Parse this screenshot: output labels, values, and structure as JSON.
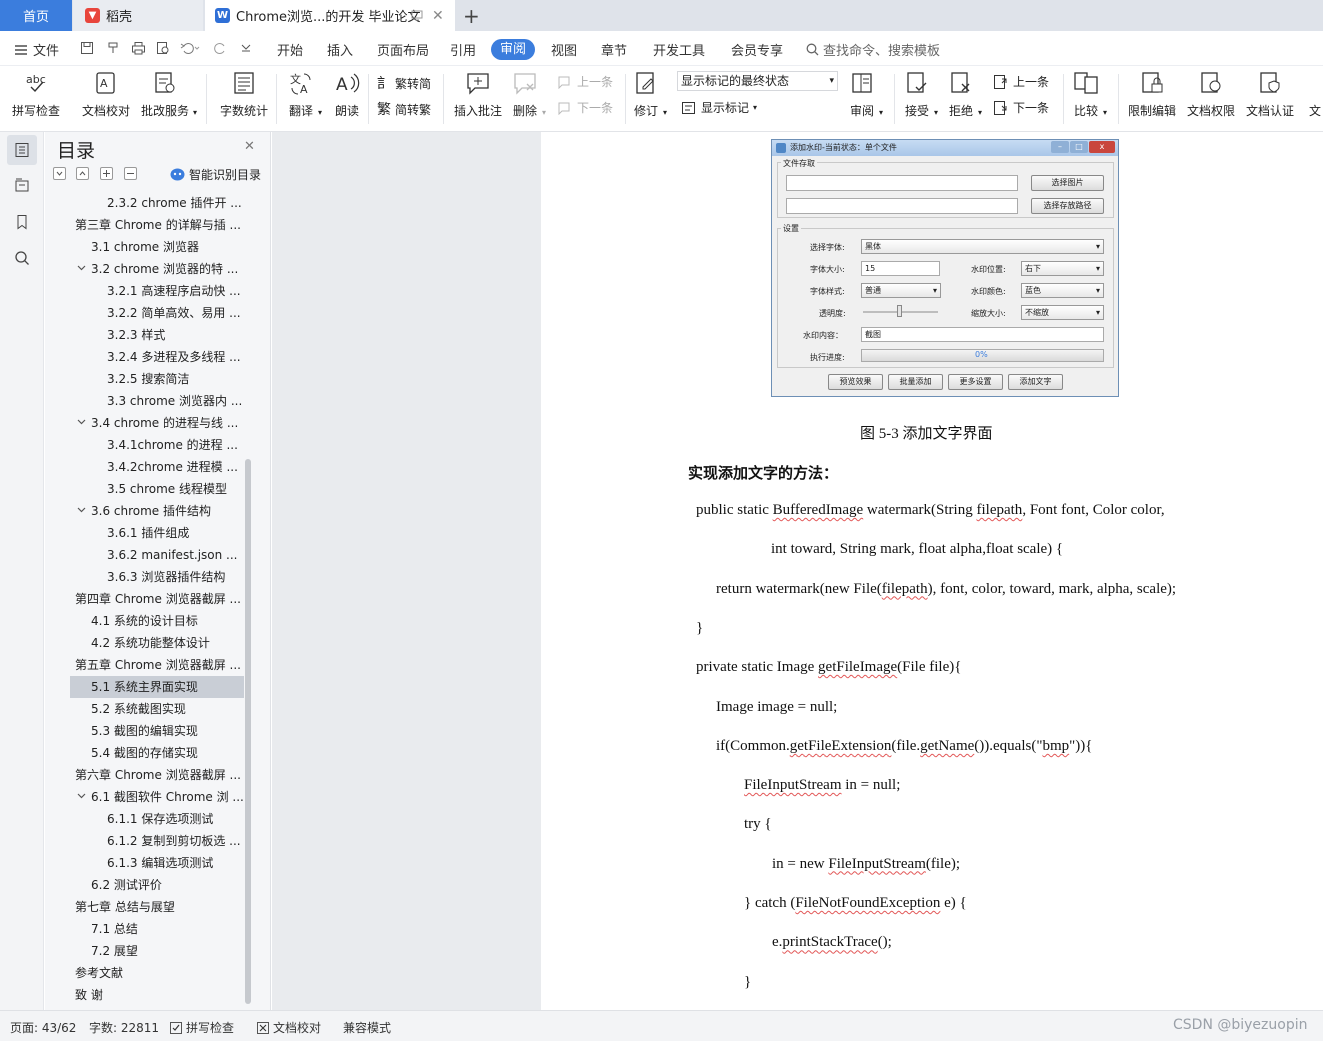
{
  "tabs": {
    "home": "首页",
    "daoke": "稻壳",
    "document": "Chrome浏览...的开发 毕业论文",
    "new_tab": "+"
  },
  "menu": {
    "file": "文件",
    "items": [
      "开始",
      "插入",
      "页面布局",
      "引用",
      "审阅",
      "视图",
      "章节",
      "开发工具",
      "会员专享"
    ],
    "search_placeholder": "查找命令、搜索模板"
  },
  "ribbon": {
    "spell_check": "拼写检查",
    "doc_proof": "文档校对",
    "revise_service": "批改服务",
    "word_count": "字数统计",
    "translate": "翻译",
    "read_aloud": "朗读",
    "trad_to_simp": "繁转简",
    "simp_to_trad": "简转繁",
    "insert_comment": "插入批注",
    "delete": "删除",
    "prev_comment": "上一条",
    "next_comment": "下一条",
    "track_changes": "修订",
    "display_state": "显示标记的最终状态",
    "show_markup": "显示标记",
    "review_pane": "审阅",
    "accept": "接受",
    "reject": "拒绝",
    "prev_change": "上一条",
    "next_change": "下一条",
    "compare": "比较",
    "restrict_edit": "限制编辑",
    "doc_permission": "文档权限",
    "doc_cert": "文档认证",
    "doc_cut": "文"
  },
  "toc": {
    "title": "目录",
    "smart_toc": "智能识别目录",
    "items": [
      {
        "label": "2.3.2 chrome 插件开 ...",
        "level": 3,
        "arrow": ""
      },
      {
        "label": "第三章  Chrome 的详解与插 ...",
        "level": 1,
        "arrow": "down"
      },
      {
        "label": "3.1 chrome 浏览器",
        "level": 2,
        "arrow": ""
      },
      {
        "label": "3.2 chrome 浏览器的特 ...",
        "level": 2,
        "arrow": "down"
      },
      {
        "label": "3.2.1 高速程序启动快 ...",
        "level": 3,
        "arrow": ""
      },
      {
        "label": "3.2.2 简单高效、易用 ...",
        "level": 3,
        "arrow": ""
      },
      {
        "label": "3.2.3 样式",
        "level": 3,
        "arrow": ""
      },
      {
        "label": "3.2.4 多进程及多线程 ...",
        "level": 3,
        "arrow": ""
      },
      {
        "label": "3.2.5 搜索简洁",
        "level": 3,
        "arrow": ""
      },
      {
        "label": "3.3 chrome 浏览器内 ...",
        "level": 3,
        "arrow": ""
      },
      {
        "label": "3.4 chrome 的进程与线 ...",
        "level": 2,
        "arrow": "down"
      },
      {
        "label": "3.4.1chrome 的进程 ...",
        "level": 3,
        "arrow": ""
      },
      {
        "label": "3.4.2chrome 进程模 ...",
        "level": 3,
        "arrow": ""
      },
      {
        "label": "3.5 chrome 线程模型",
        "level": 3,
        "arrow": ""
      },
      {
        "label": "3.6 chrome 插件结构",
        "level": 2,
        "arrow": "down"
      },
      {
        "label": "3.6.1 插件组成",
        "level": 3,
        "arrow": ""
      },
      {
        "label": "3.6.2 manifest.json ...",
        "level": 3,
        "arrow": ""
      },
      {
        "label": "3.6.3 浏览器插件结构",
        "level": 3,
        "arrow": ""
      },
      {
        "label": "第四章  Chrome 浏览器截屏 ...",
        "level": 1,
        "arrow": "down"
      },
      {
        "label": "4.1 系统的设计目标",
        "level": 2,
        "arrow": ""
      },
      {
        "label": "4.2 系统功能整体设计",
        "level": 2,
        "arrow": ""
      },
      {
        "label": "第五章  Chrome 浏览器截屏 ...",
        "level": 1,
        "arrow": "down"
      },
      {
        "label": "5.1 系统主界面实现",
        "level": 2,
        "arrow": "",
        "selected": true
      },
      {
        "label": "5.2 系统截图实现",
        "level": 2,
        "arrow": ""
      },
      {
        "label": "5.3 截图的编辑实现",
        "level": 2,
        "arrow": ""
      },
      {
        "label": "5.4 截图的存储实现",
        "level": 2,
        "arrow": ""
      },
      {
        "label": "第六章  Chrome 浏览器截屏 ...",
        "level": 1,
        "arrow": "down"
      },
      {
        "label": "6.1 截图软件 Chrome 浏 ...",
        "level": 2,
        "arrow": "down"
      },
      {
        "label": "6.1.1 保存选项测试",
        "level": 3,
        "arrow": ""
      },
      {
        "label": "6.1.2 复制到剪切板选 ...",
        "level": 3,
        "arrow": ""
      },
      {
        "label": "6.1.3 编辑选项测试",
        "level": 3,
        "arrow": ""
      },
      {
        "label": "6.2 测试评价",
        "level": 2,
        "arrow": ""
      },
      {
        "label": "第七章  总结与展望",
        "level": 1,
        "arrow": "down"
      },
      {
        "label": "7.1 总结",
        "level": 2,
        "arrow": ""
      },
      {
        "label": "7.2 展望",
        "level": 2,
        "arrow": ""
      },
      {
        "label": "参考文献",
        "level": 1,
        "arrow": ""
      },
      {
        "label": "致    谢",
        "level": 1,
        "arrow": ""
      }
    ]
  },
  "dialog": {
    "title": "添加水印-当前状态：单个文件",
    "file_group": "文件存取",
    "select_image": "选择图片",
    "select_save_path": "选择存放路径",
    "settings_group": "设置",
    "font_label": "选择字体:",
    "font_value": "黑体",
    "font_size_label": "字体大小:",
    "font_size_value": "15",
    "position_label": "水印位置:",
    "position_value": "右下",
    "font_style_label": "字体样式:",
    "font_style_value": "普通",
    "color_label": "水印颜色:",
    "color_value": "蓝色",
    "opacity_label": "透明度:",
    "scale_label": "缩放大小:",
    "scale_value": "不缩放",
    "content_label": "水印内容：",
    "content_value": "截图",
    "progress_label": "执行进度:",
    "progress_value": "0%",
    "btn_preview": "预览效果",
    "btn_batch": "批量添加",
    "btn_more": "更多设置",
    "btn_add_text": "添加文字"
  },
  "document": {
    "caption": "图 5-3   添加文字界面",
    "heading": "实现添加文字的方法：",
    "code_lines": [
      {
        "parts": [
          {
            "t": "public static "
          },
          {
            "t": "BufferedImage",
            "w": true
          },
          {
            "t": " watermark(String "
          },
          {
            "t": "filepath",
            "w": true
          },
          {
            "t": ", Font font, Color color,"
          }
        ]
      },
      {
        "parts": [
          {
            "t": "int toward, String mark, float alpha,float scale) {"
          }
        ]
      },
      {
        "parts": [
          {
            "t": "return watermark(new File("
          },
          {
            "t": "filepath",
            "w": true
          },
          {
            "t": "), font, color, toward, mark, alpha, scale);"
          }
        ]
      },
      {
        "parts": [
          {
            "t": "}"
          }
        ]
      },
      {
        "parts": [
          {
            "t": "private static Image "
          },
          {
            "t": "getFileImage",
            "w": true
          },
          {
            "t": "(File file){"
          }
        ]
      },
      {
        "parts": [
          {
            "t": "Image image = null;"
          }
        ]
      },
      {
        "parts": [
          {
            "t": "if(Common."
          },
          {
            "t": "getFileExtension",
            "w": true
          },
          {
            "t": "(file."
          },
          {
            "t": "getName",
            "w": true
          },
          {
            "t": "()).equals(\""
          },
          {
            "t": "bmp",
            "w": true
          },
          {
            "t": "\")){"
          }
        ]
      },
      {
        "parts": [
          {
            "t": "FileInputStream",
            "w": true
          },
          {
            "t": " in = null;"
          }
        ]
      },
      {
        "parts": [
          {
            "t": "try {"
          }
        ]
      },
      {
        "parts": [
          {
            "t": "in = new "
          },
          {
            "t": "FileInputStream",
            "w": true
          },
          {
            "t": "(file);"
          }
        ]
      },
      {
        "parts": [
          {
            "t": "} catch ("
          },
          {
            "t": "FileNotFoundException",
            "w": true
          },
          {
            "t": " e) {"
          }
        ]
      },
      {
        "parts": [
          {
            "t": "e."
          },
          {
            "t": "printStackTrace",
            "w": true
          },
          {
            "t": "();"
          }
        ]
      },
      {
        "parts": [
          {
            "t": "}"
          }
        ]
      }
    ]
  },
  "status": {
    "page": "页面: 43/62",
    "words": "字数: 22811",
    "spell": "拼写检查",
    "proof": "文档校对",
    "compat": "兼容模式",
    "watermark": "CSDN @biyezuopin"
  },
  "colors": {
    "accent": "#3b7ddd",
    "daoke_red": "#e8453c",
    "wps_blue": "#2f6fd6"
  }
}
